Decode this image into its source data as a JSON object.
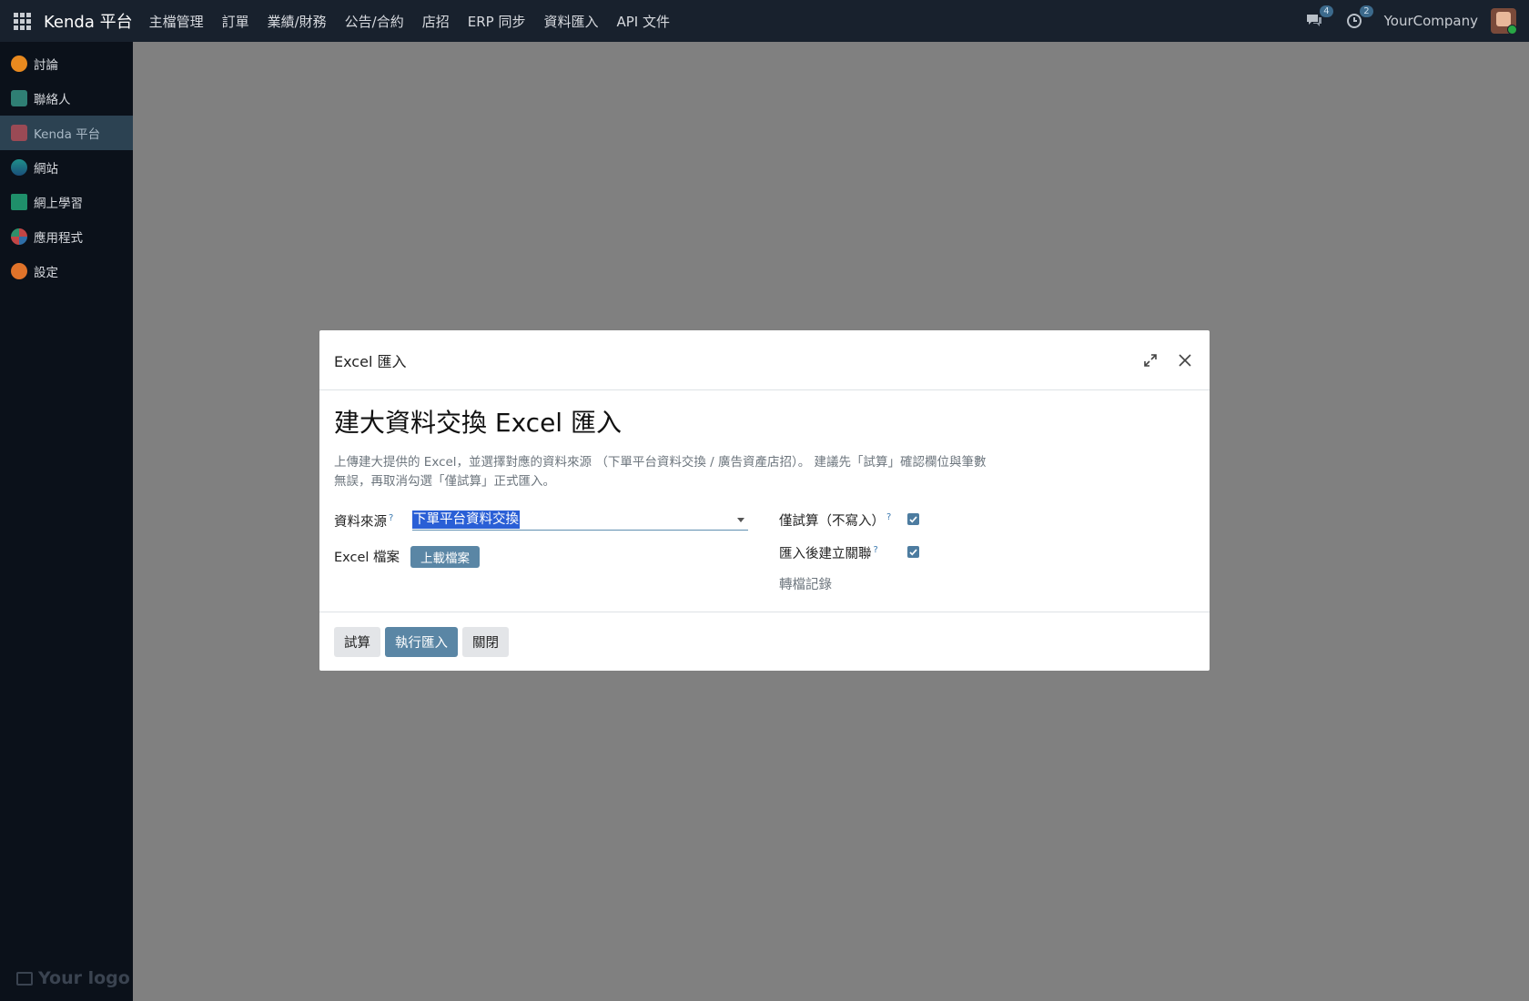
{
  "topbar": {
    "brand": "Kenda 平台",
    "menu": [
      "主檔管理",
      "訂單",
      "業績/財務",
      "公告/合約",
      "店招",
      "ERP 同步",
      "資料匯入",
      "API 文件"
    ],
    "messages_badge": "4",
    "activity_badge": "2",
    "company": "YourCompany"
  },
  "sidebar": {
    "items": [
      {
        "label": "討論",
        "icon": "discuss-icon",
        "color": "#e8891f"
      },
      {
        "label": "聯絡人",
        "icon": "contacts-icon",
        "color": "#2f7f74"
      },
      {
        "label": "Kenda 平台",
        "icon": "kenda-platform-icon",
        "color": "#9a4a55",
        "active": true
      },
      {
        "label": "網站",
        "icon": "website-icon",
        "color": "#1f8f8a"
      },
      {
        "label": "網上學習",
        "icon": "elearning-icon",
        "color": "#1f8f6a"
      },
      {
        "label": "應用程式",
        "icon": "apps-icon",
        "color": "#c24545"
      },
      {
        "label": "設定",
        "icon": "settings-icon",
        "color": "#e0732a"
      }
    ],
    "logo_text": "Your logo"
  },
  "dialog": {
    "title": "Excel 匯入",
    "heading": "建大資料交換 Excel 匯入",
    "description": "上傳建大提供的 Excel，並選擇對應的資料來源 （下單平台資料交換 / 廣告資產店招）。 建議先「試算」確認欄位與筆數無誤，再取消勾選「僅試算」正式匯入。",
    "source_label": "資料來源",
    "source_value": "下單平台資料交換",
    "file_label": "Excel 檔案",
    "upload_label": "上載檔案",
    "dry_run_label": "僅試算（不寫入）",
    "dry_run_checked": true,
    "link_after_label": "匯入後建立關聯",
    "link_after_checked": true,
    "log_label": "轉檔記錄",
    "help_mark": "?",
    "buttons": {
      "dry_run": "試算",
      "execute": "執行匯入",
      "close": "關閉"
    }
  }
}
